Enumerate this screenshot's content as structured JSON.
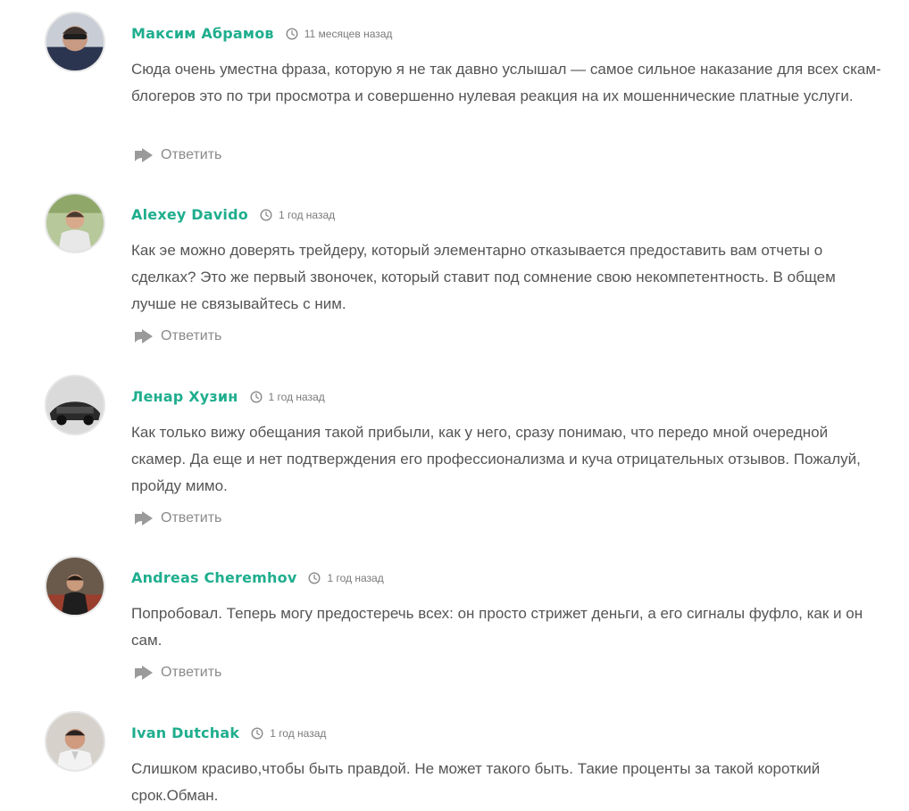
{
  "comments": [
    {
      "author": "Максим Абрамов",
      "time": "11 месяцев назад",
      "text": "Сюда очень уместна фраза, которую я не так давно услышал — самое сильное наказание для всех скам-блогеров это по три просмотра и совершенно нулевая реакция на их мошеннические платные услуги.",
      "reply_label": "Ответить"
    },
    {
      "author": "Alexey Davido",
      "time": "1 год назад",
      "text": "Как эе можно доверять трейдеру, который элементарно отказывается предоставить вам отчеты о сделках? Это же первый звоночек, который ставит под сомнение свою некомпетентность. В общем лучше не связывайтесь с ним.",
      "reply_label": "Ответить"
    },
    {
      "author": "Ленар Хузин",
      "time": "1 год назад",
      "text": "Как только вижу обещания такой прибыли, как у него, сразу понимаю, что передо мной очередной скамер. Да еще и нет подтверждения его профессионализма и куча отрицательных отзывов. Пожалуй, пройду мимо.",
      "reply_label": "Ответить"
    },
    {
      "author": "Andreas Cheremhov",
      "time": "1 год назад",
      "text": "Попробовал. Теперь могу предостеречь всех: он просто стрижет деньги, а его сигналы фуфло, как и он сам.",
      "reply_label": "Ответить"
    },
    {
      "author": "Ivan Dutchak",
      "time": "1 год назад",
      "text": "Слишком красиво,чтобы быть правдой. Не может такого быть. Такие проценты за такой короткий срок.Обман.",
      "reply_label": ""
    }
  ],
  "colors": {
    "author": "#1fae8e",
    "text": "#555555",
    "meta": "#7a7a7a",
    "reply": "#8a8a8a"
  },
  "icons": {
    "time": "clock-icon",
    "reply": "reply-arrow-icon",
    "avatar": "user-avatar-photo"
  }
}
